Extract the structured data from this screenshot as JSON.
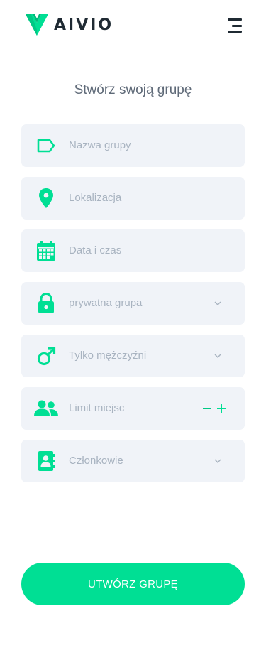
{
  "header": {
    "brand": "AIVIO",
    "logo_icon": "aivio-v-logo",
    "menu_icon": "hamburger-menu-icon"
  },
  "page": {
    "title": "Stwórz swoją grupę"
  },
  "form": {
    "fields": [
      {
        "icon": "tag-icon",
        "placeholder": "Nazwa grupy",
        "type": "text"
      },
      {
        "icon": "location-pin-icon",
        "placeholder": "Lokalizacja",
        "type": "text"
      },
      {
        "icon": "calendar-icon",
        "placeholder": "Data i czas",
        "type": "text"
      },
      {
        "icon": "lock-icon",
        "placeholder": "prywatna grupa",
        "type": "select"
      },
      {
        "icon": "male-gender-icon",
        "placeholder": "Tylko mężczyźni",
        "type": "select"
      },
      {
        "icon": "users-icon",
        "placeholder": "Limit miejsc",
        "type": "stepper"
      },
      {
        "icon": "contact-book-icon",
        "placeholder": "Członkowie",
        "type": "select"
      }
    ],
    "stepper": {
      "minus": "−",
      "plus": "+"
    },
    "submit_label": "UTWÓRZ GRUPĘ"
  },
  "colors": {
    "accent": "#00df94",
    "field_bg": "#f0f3f8",
    "placeholder": "#a8b3c0",
    "title": "#5f6a78",
    "dark": "#1f2a33"
  }
}
